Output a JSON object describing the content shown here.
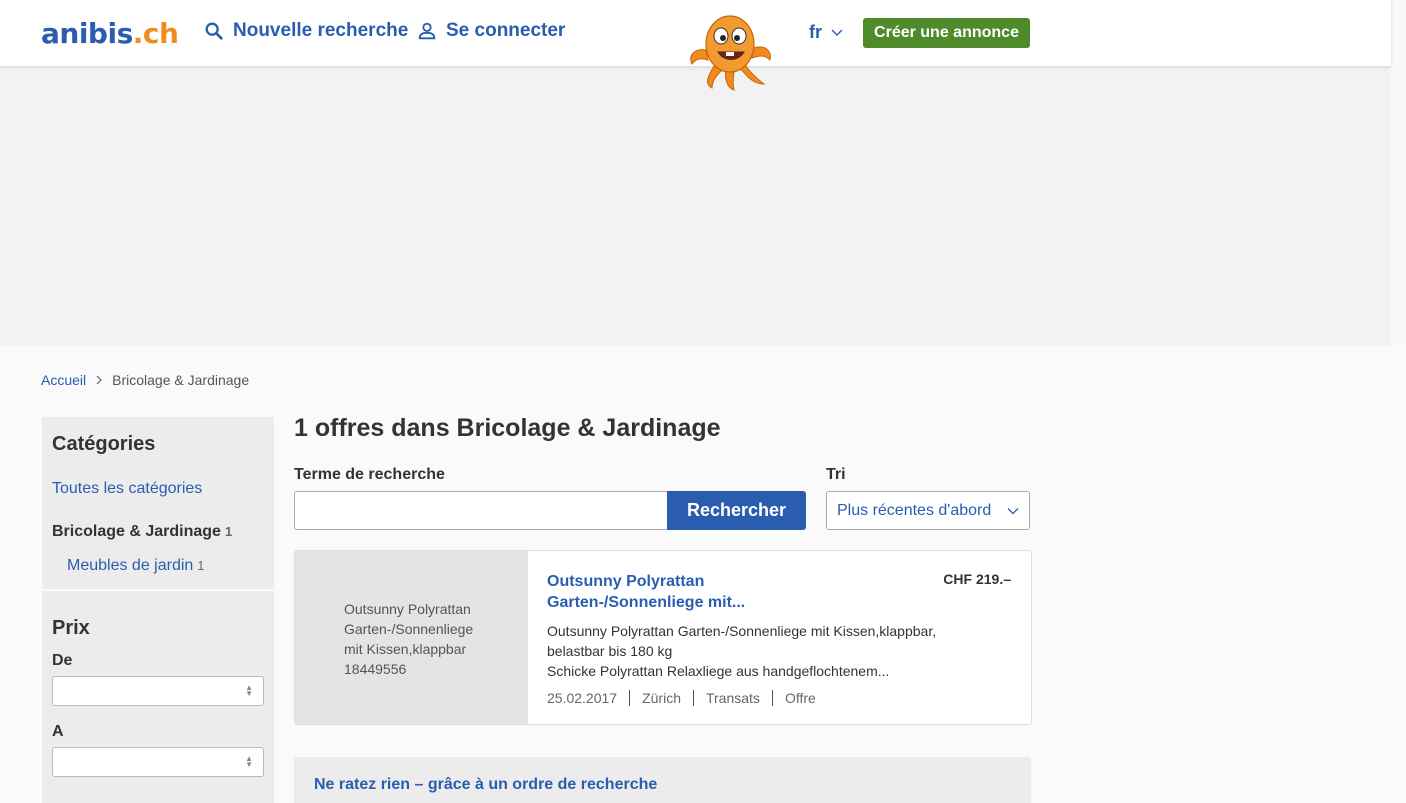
{
  "header": {
    "logo_main": "anibis",
    "logo_tld": ".ch",
    "new_search": "Nouvelle recherche",
    "login": "Se connecter",
    "language": "fr",
    "create_ad": "Créer une annonce"
  },
  "breadcrumb": {
    "home": "Accueil",
    "current": "Bricolage & Jardinage"
  },
  "sidebar": {
    "categories_title": "Catégories",
    "all_categories": "Toutes les catégories",
    "category": {
      "label": "Bricolage & Jardinage",
      "count": "1"
    },
    "subcategory": {
      "label": "Meubles de jardin",
      "count": "1"
    },
    "price_title": "Prix",
    "from_label": "De",
    "to_label": "A"
  },
  "results": {
    "title": "1 offres dans Bricolage & Jardinage",
    "search_label": "Terme de recherche",
    "search_button": "Rechercher",
    "sort_label": "Tri",
    "sort_value": "Plus récentes d'abord"
  },
  "listing": {
    "image_alt": "Outsunny Polyrattan Garten-/Sonnenliege mit Kissen,klappbar 18449556",
    "title": "Outsunny Polyrattan Garten-/Sonnenliege mit...",
    "price": "CHF 219.–",
    "desc_line1": "Outsunny Polyrattan Garten-/Sonnenliege mit Kissen,klappbar, belastbar bis 180 kg",
    "desc_line2": "Schicke Polyrattan Relaxliege aus handgeflochtenem...",
    "date": "25.02.2017",
    "location": "Zürich",
    "category": "Transats",
    "type": "Offre"
  },
  "promo": {
    "text": "Ne ratez rien – grâce à un ordre de recherche"
  },
  "colors": {
    "brand_blue": "#2a5db0",
    "brand_orange": "#f08c1c",
    "create_green": "#4f8a2b"
  }
}
